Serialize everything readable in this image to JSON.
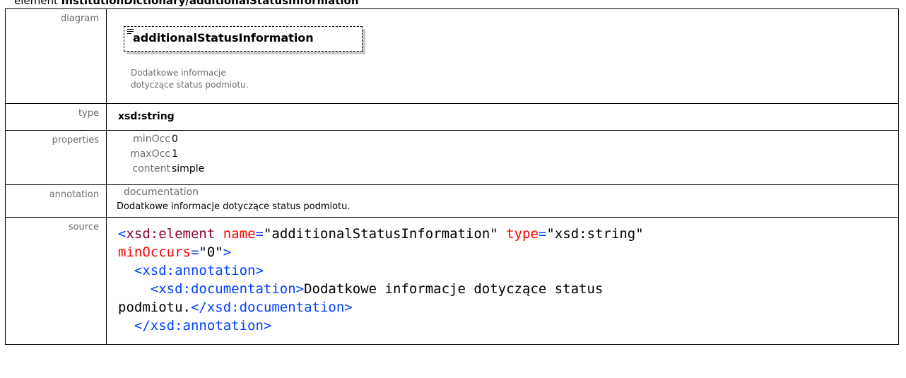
{
  "heading": {
    "prefix": "element ",
    "path": "InstitutionDictionary/additionalStatusInformation"
  },
  "rows": {
    "diagram": {
      "label": "diagram",
      "element_name": "additionalStatusInformation",
      "doc": "Dodatkowe informacje dotyczące status podmiotu."
    },
    "type": {
      "label": "type",
      "value": "xsd:string"
    },
    "properties": {
      "label": "properties",
      "items": [
        {
          "key": "minOcc",
          "value": "0"
        },
        {
          "key": "maxOcc",
          "value": "1"
        },
        {
          "key": "content",
          "value": "simple"
        }
      ]
    },
    "annotation": {
      "label": "annotation",
      "key": "documentation",
      "value": "Dodatkowe informacje dotyczące status podmiotu."
    },
    "source": {
      "label": "source",
      "l1_open": "<",
      "l1_tag": "xsd:element",
      "l1_attr1": "name",
      "l1_eq1": "=",
      "l1_val1": "\"additionalStatusInformation\"",
      "l1_attr2": "type",
      "l1_eq2": "=",
      "l1_val2": "\"xsd:string\"",
      "l2_attr": "minOccurs",
      "l2_eq": "=",
      "l2_val": "\"0\"",
      "l2_close": ">",
      "l3_tag": "<xsd:annotation>",
      "l4_tag": "<xsd:documentation>",
      "l4_text": "Dodatkowe informacje dotyczące status",
      "l5_text": "podmiotu.",
      "l5_tag": "</xsd:documentation>",
      "l6_tag": "</xsd:annotation>"
    }
  }
}
